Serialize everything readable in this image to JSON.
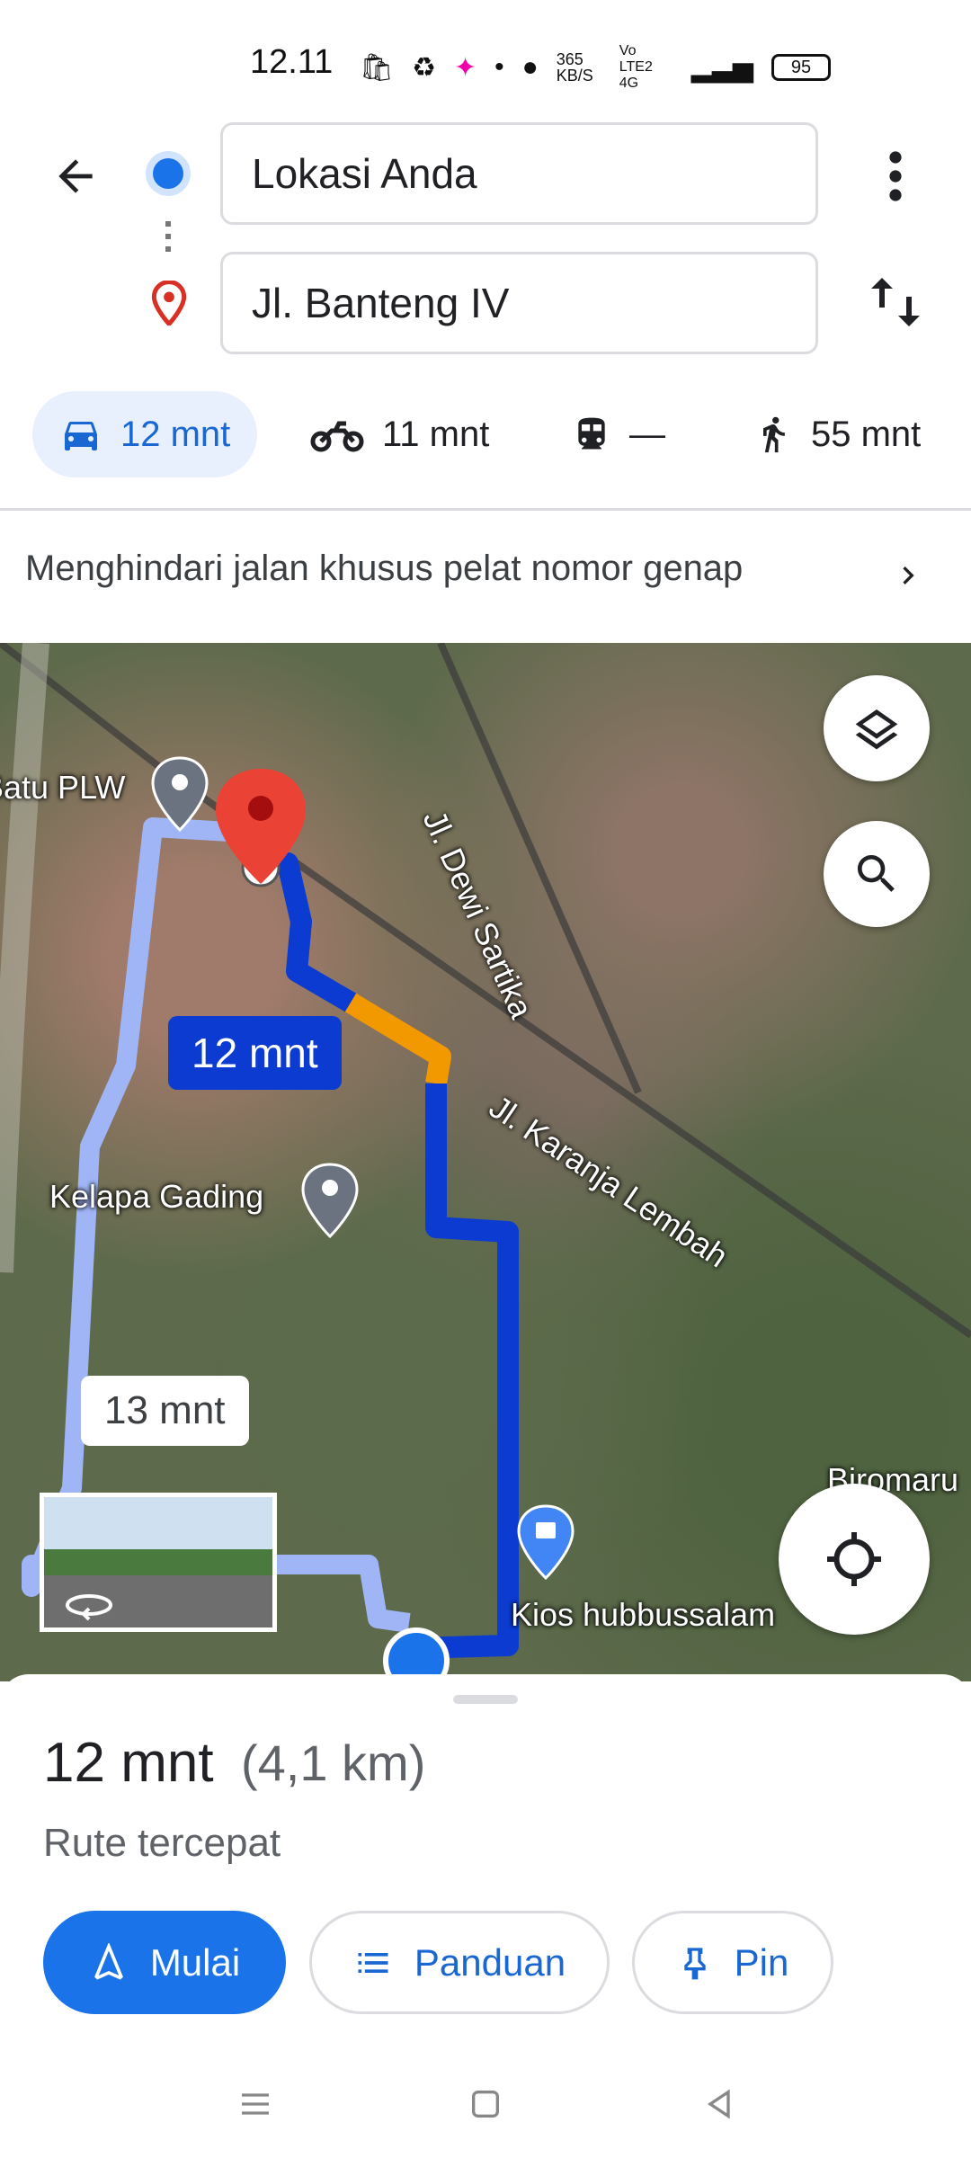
{
  "status_bar": {
    "time": "12.11",
    "speed": "365 KB/S",
    "network": "Vo LTE2 4G",
    "battery": "95"
  },
  "header": {
    "origin_value": "Lokasi Anda",
    "destination_value": "Jl. Banteng IV"
  },
  "modes": [
    {
      "icon": "car-icon",
      "label": "12 mnt",
      "active": true
    },
    {
      "icon": "motorcycle-icon",
      "label": "11 mnt"
    },
    {
      "icon": "transit-icon",
      "label": "—"
    },
    {
      "icon": "walk-icon",
      "label": "55 mnt"
    }
  ],
  "notice": "Menghindari jalan khusus pelat nomor genap",
  "map": {
    "labels": {
      "batu_plw": "Batu PLW",
      "dewi_sartika": "Jl. Dewi Sartika",
      "karanja_lembah": "Jl. Karanja Lembah",
      "kelapa_gading": "Kelapa Gading",
      "kios": "Kios hubbussalam",
      "biromaru": "Biromaru"
    },
    "route_primary_time": "12 mnt",
    "route_alt_time": "13 mnt",
    "colors": {
      "route": "#0b3bd1",
      "alt_route": "#9fb5f5",
      "traffic": "#f29900",
      "pin": "#ea4335"
    }
  },
  "sheet": {
    "duration": "12 mnt",
    "distance": "(4,1 km)",
    "description": "Rute tercepat",
    "buttons": {
      "start": "Mulai",
      "guide": "Panduan",
      "pin": "Pin"
    }
  }
}
